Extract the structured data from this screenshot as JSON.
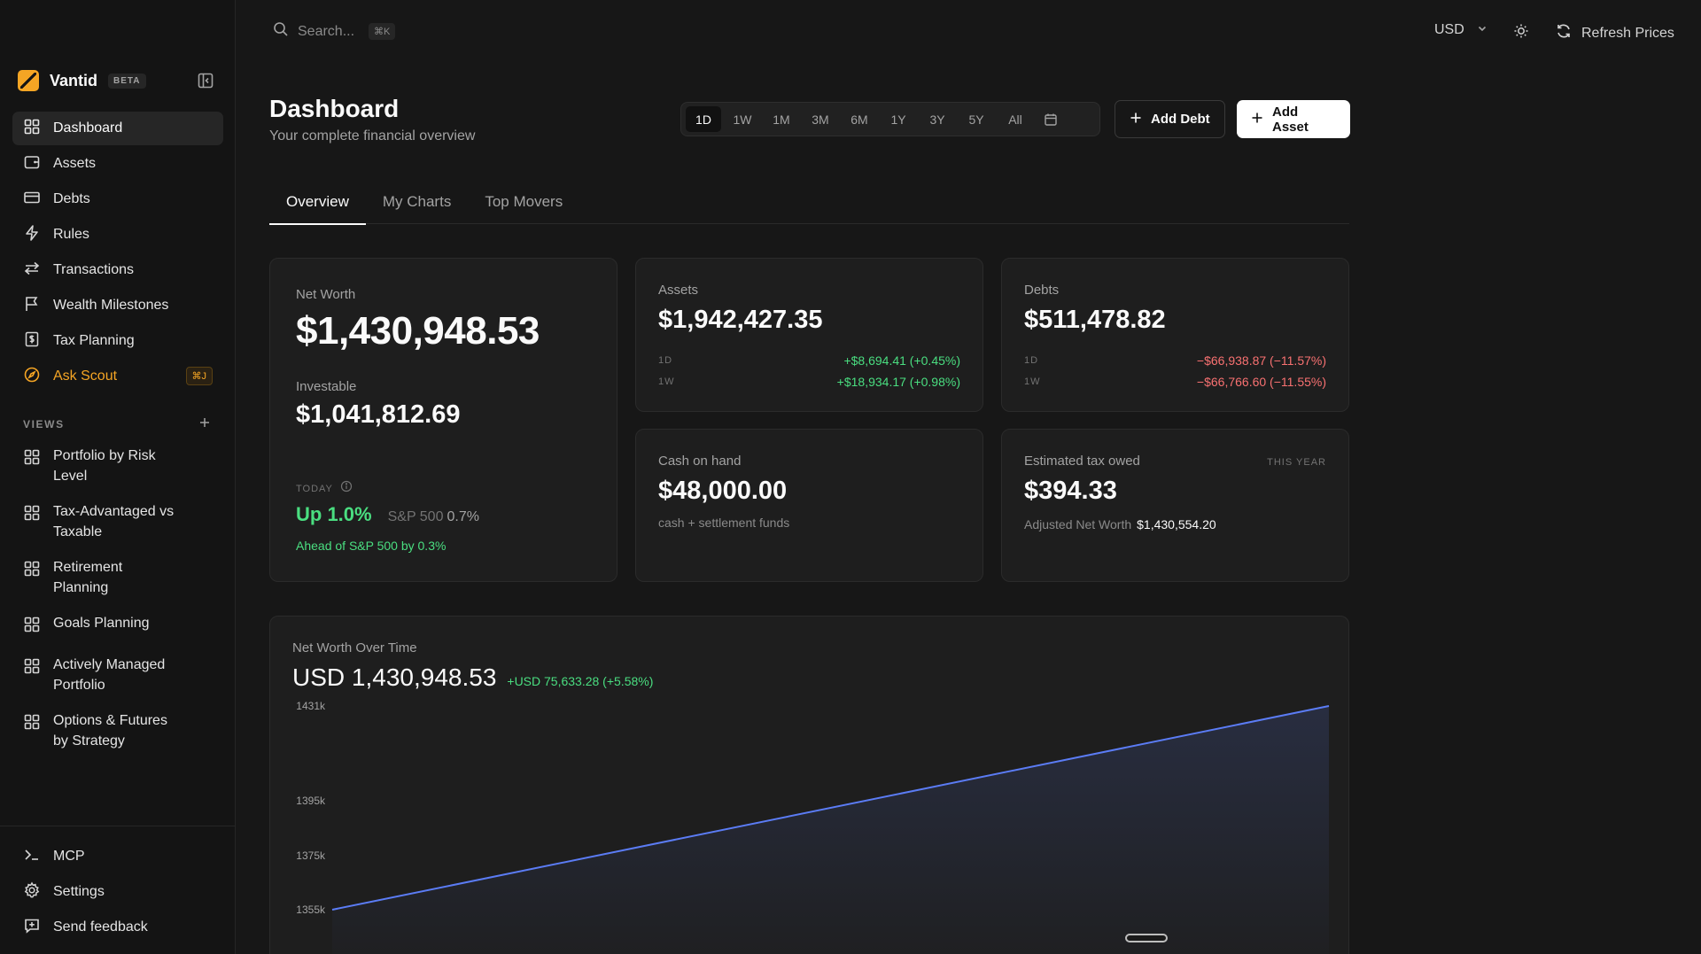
{
  "app": {
    "name": "Vantid",
    "badge": "BETA"
  },
  "sidebar": {
    "items": [
      {
        "label": "Dashboard"
      },
      {
        "label": "Assets"
      },
      {
        "label": "Debts"
      },
      {
        "label": "Rules"
      },
      {
        "label": "Transactions"
      },
      {
        "label": "Wealth Milestones"
      },
      {
        "label": "Tax Planning"
      },
      {
        "label": "Ask Scout",
        "shortcut": "⌘J"
      }
    ],
    "views_title": "VIEWS",
    "views": [
      {
        "label": "Portfolio by Risk Level"
      },
      {
        "label": "Tax-Advantaged vs Taxable"
      },
      {
        "label": "Retirement Planning"
      },
      {
        "label": "Goals Planning"
      },
      {
        "label": "Actively Managed Portfolio"
      },
      {
        "label": "Options & Futures by Strategy"
      }
    ],
    "footer": [
      {
        "label": "MCP"
      },
      {
        "label": "Settings"
      },
      {
        "label": "Send feedback"
      }
    ]
  },
  "topbar": {
    "search_placeholder": "Search...",
    "search_shortcut": "⌘K",
    "currency": "USD",
    "refresh_label": "Refresh Prices"
  },
  "page": {
    "title": "Dashboard",
    "subtitle": "Your complete financial overview"
  },
  "ranges": [
    "1D",
    "1W",
    "1M",
    "3M",
    "6M",
    "1Y",
    "3Y",
    "5Y",
    "All"
  ],
  "selected_range": "1D",
  "buttons": {
    "add_debt": "Add Debt",
    "add_asset": "Add Asset"
  },
  "tabs": [
    "Overview",
    "My Charts",
    "Top Movers"
  ],
  "net_worth": {
    "label": "Net Worth",
    "value": "$1,430,948.53",
    "investable_label": "Investable",
    "investable_value": "$1,041,812.69",
    "today_label": "TODAY",
    "up": "Up 1.0%",
    "sp_label": "S&P 500",
    "sp_value": "0.7%",
    "ahead": "Ahead of S&P 500 by 0.3%"
  },
  "assets": {
    "label": "Assets",
    "value": "$1,942,427.35",
    "rows": [
      {
        "period": "1D",
        "change": "+$8,694.41 (+0.45%)"
      },
      {
        "period": "1W",
        "change": "+$18,934.17 (+0.98%)"
      }
    ]
  },
  "debts": {
    "label": "Debts",
    "value": "$511,478.82",
    "rows": [
      {
        "period": "1D",
        "change": "−$66,938.87 (−11.57%)"
      },
      {
        "period": "1W",
        "change": "−$66,766.60 (−11.55%)"
      }
    ]
  },
  "cash": {
    "label": "Cash on hand",
    "value": "$48,000.00",
    "note": "cash + settlement funds"
  },
  "tax": {
    "label": "Estimated tax owed",
    "period": "THIS YEAR",
    "value": "$394.33",
    "adjusted_label": "Adjusted Net Worth",
    "adjusted_value": "$1,430,554.20"
  },
  "chart_card": {
    "title": "Net Worth Over Time",
    "value": "USD 1,430,948.53",
    "change": "+USD 75,633.28 (+5.58%)"
  },
  "chart_data": {
    "type": "area",
    "title": "Net Worth Over Time",
    "y_ticks": [
      "1431k",
      "1395k",
      "1375k",
      "1355k"
    ],
    "y_tick_values": [
      1431,
      1395,
      1375,
      1355
    ],
    "x": [
      0,
      1
    ],
    "values": [
      1355,
      1431
    ],
    "ylim": [
      1355,
      1431
    ],
    "line_color": "#5b7cf5",
    "grid": false
  },
  "colors": {
    "accent": "#f5a524",
    "positive": "#4ade80",
    "negative": "#f87171",
    "line": "#5b7cf5"
  }
}
